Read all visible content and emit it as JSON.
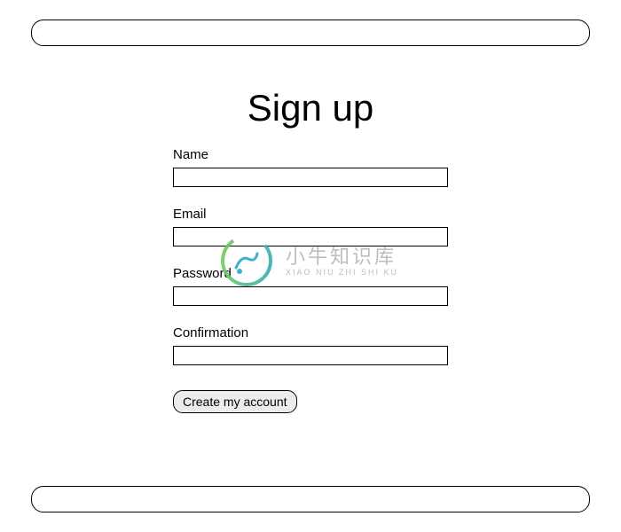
{
  "header": {
    "content": ""
  },
  "footer": {
    "content": ""
  },
  "page": {
    "title": "Sign up"
  },
  "form": {
    "name": {
      "label": "Name",
      "value": ""
    },
    "email": {
      "label": "Email",
      "value": ""
    },
    "password": {
      "label": "Password",
      "value": ""
    },
    "confirmation": {
      "label": "Confirmation",
      "value": ""
    },
    "submit_label": "Create my account"
  },
  "watermark": {
    "title_cn": "小牛知识库",
    "pinyin": "XIAO NIU ZHI SHI KU"
  }
}
